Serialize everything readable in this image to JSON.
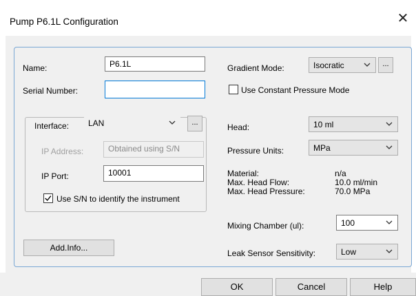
{
  "window": {
    "title": "Pump P6.1L Configuration"
  },
  "left": {
    "name_label": "Name:",
    "name_value": "P6.1L",
    "serial_label": "Serial Number:",
    "serial_value": "",
    "interface_label": "Interface:",
    "interface_value": "LAN",
    "interface_more": "...",
    "ip_address_label": "IP Address:",
    "ip_address_value": "Obtained using S/N",
    "ip_port_label": "IP Port:",
    "ip_port_value": "10001",
    "use_sn_label": "Use S/N to identify the instrument",
    "use_sn_checked": true,
    "add_info_label": "Add.Info..."
  },
  "right": {
    "gradient_label": "Gradient Mode:",
    "gradient_value": "Isocratic",
    "gradient_more": "...",
    "constant_pressure_label": "Use Constant Pressure Mode",
    "constant_pressure_checked": false,
    "head_label": "Head:",
    "head_value": "10 ml",
    "pressure_units_label": "Pressure Units:",
    "pressure_units_value": "MPa",
    "material_label": "Material:",
    "material_value": "n/a",
    "max_flow_label": "Max. Head Flow:",
    "max_flow_value": "10.0 ml/min",
    "max_pressure_label": "Max. Head Pressure:",
    "max_pressure_value": "70.0 MPa",
    "mixing_label": "Mixing Chamber (ul):",
    "mixing_value": "100",
    "leak_label": "Leak Sensor Sensitivity:",
    "leak_value": "Low"
  },
  "footer": {
    "ok": "OK",
    "cancel": "Cancel",
    "help": "Help"
  },
  "icons": {
    "close": "close-icon",
    "dropdown": "chevron-down-icon",
    "check": "checkmark-icon"
  }
}
